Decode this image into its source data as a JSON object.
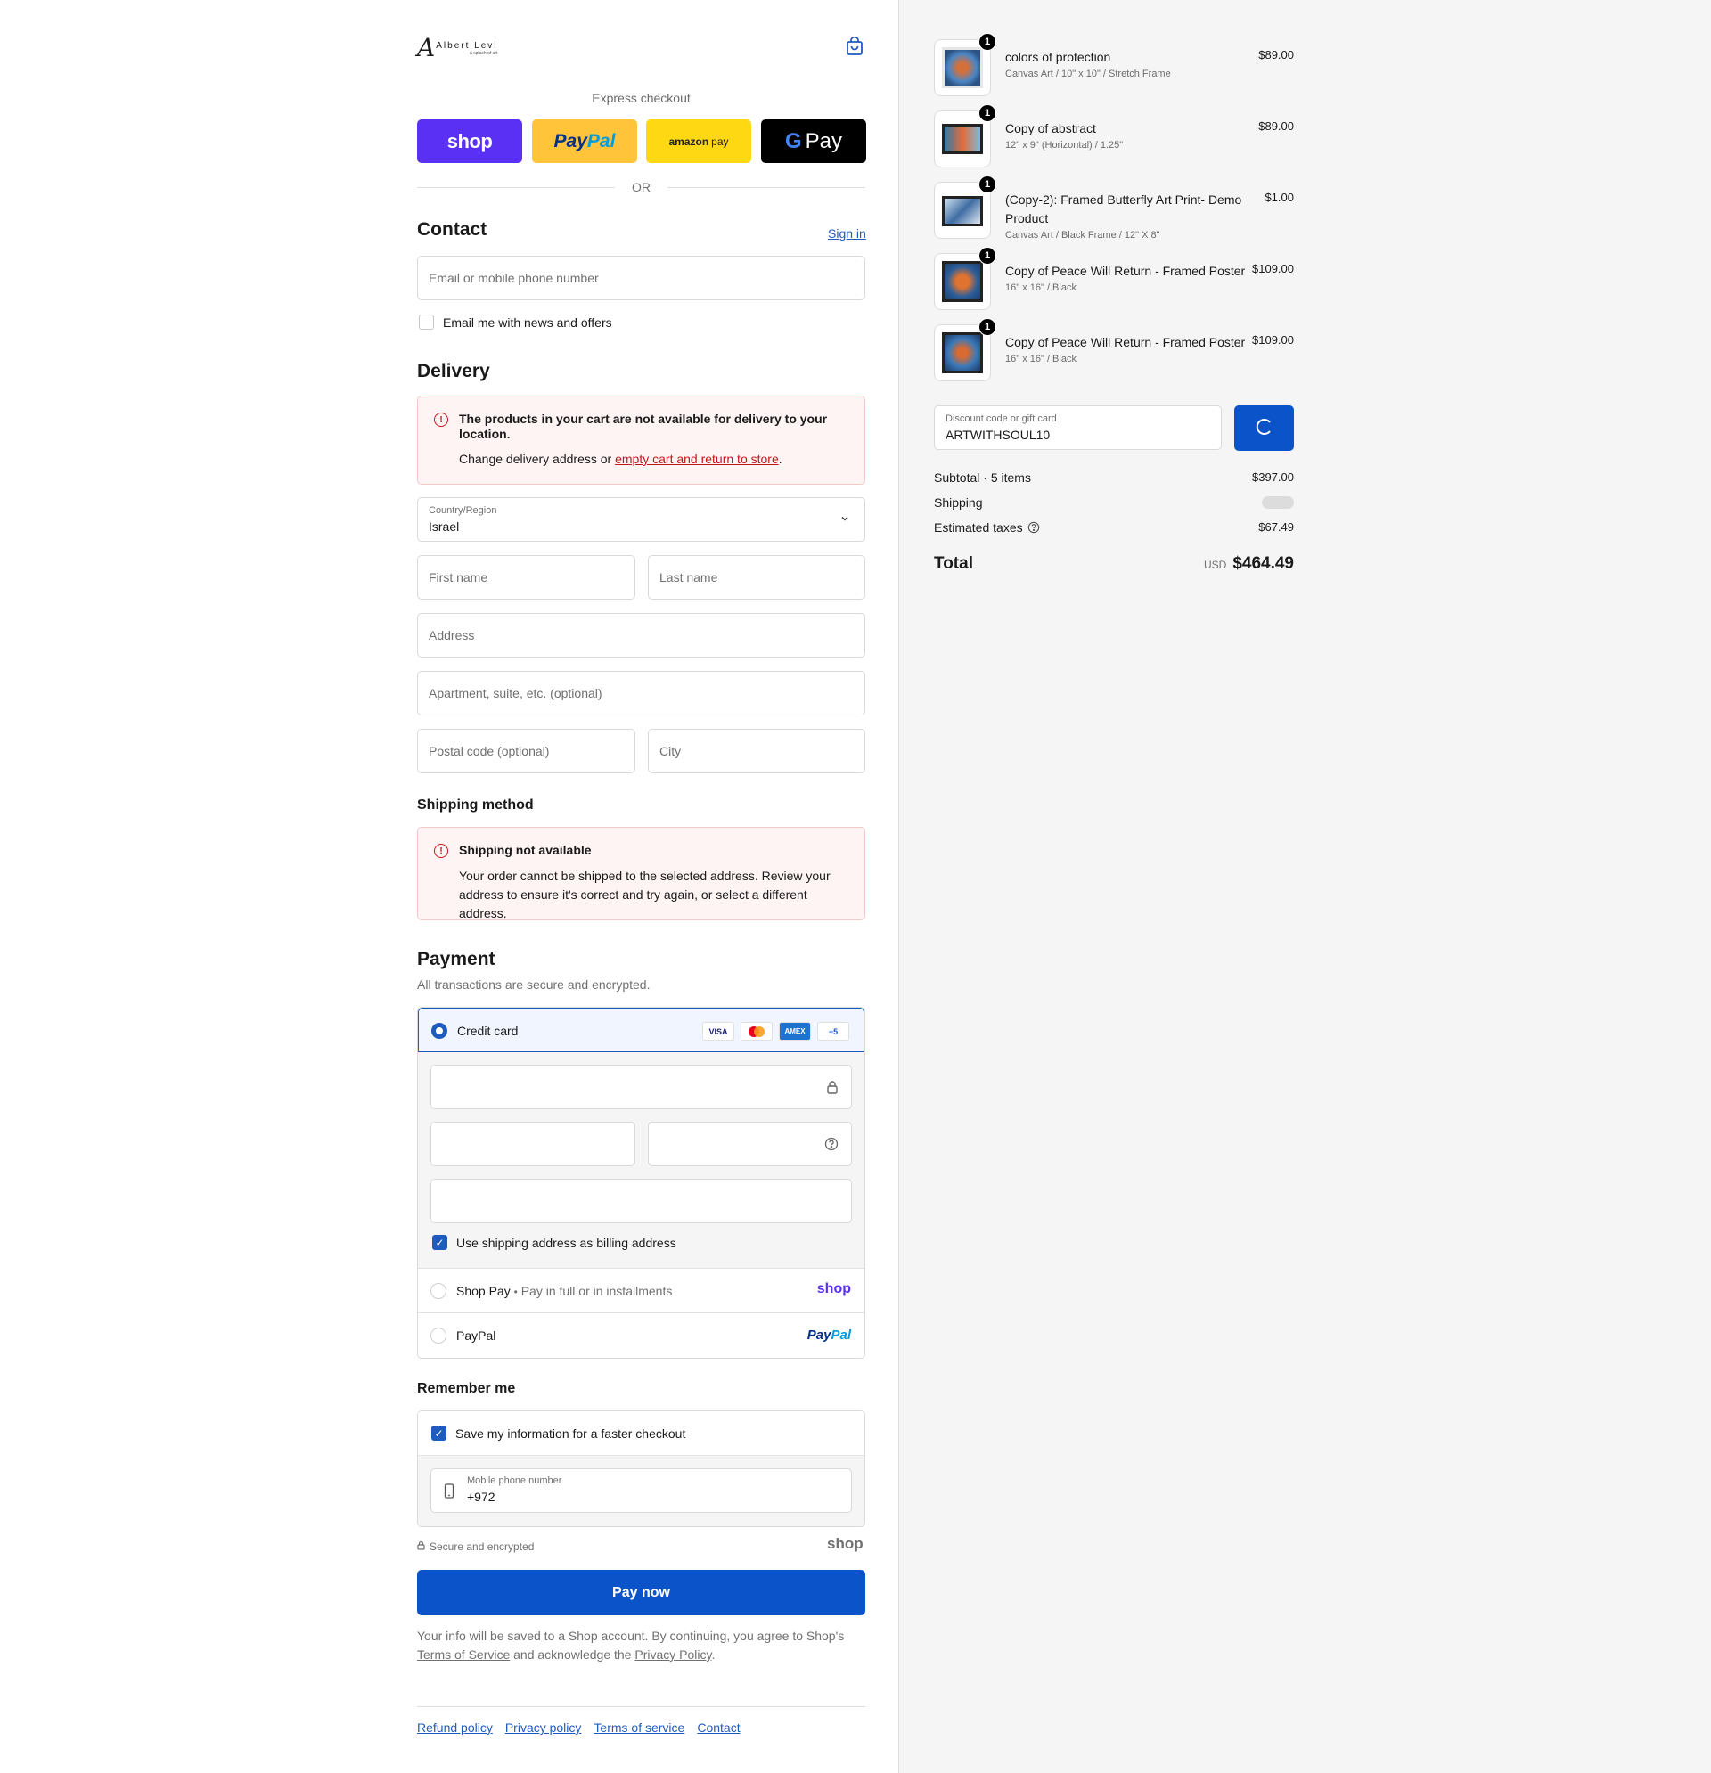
{
  "store": {
    "logo_script": "A",
    "logo_name": "Albert Levi",
    "logo_tagline": "A splash of art"
  },
  "express": {
    "title": "Express checkout",
    "shop_label": "shop",
    "paypal_pay": "Pay",
    "paypal_pal": "Pal",
    "amazon_label": "amazon",
    "amazon_pay": "pay",
    "gpay_g": "G",
    "gpay_label": "Pay",
    "or_label": "OR"
  },
  "contact": {
    "heading": "Contact",
    "sign_in": "Sign in",
    "email_placeholder": "Email or mobile phone number",
    "newsletter_label": "Email me with news and offers",
    "newsletter_checked": false
  },
  "delivery": {
    "heading": "Delivery",
    "alert_title": "The products in your cart are not available for delivery to your location.",
    "alert_body_prefix": "Change delivery address or ",
    "alert_link": "empty cart and return to store",
    "alert_body_suffix": ".",
    "country_label": "Country/Region",
    "country_value": "Israel",
    "first_name": "First name",
    "last_name": "Last name",
    "address": "Address",
    "apartment": "Apartment, suite, etc. (optional)",
    "postal": "Postal code (optional)",
    "city": "City"
  },
  "shipping": {
    "heading": "Shipping method",
    "alert_title": "Shipping not available",
    "alert_body": "Your order cannot be shipped to the selected address. Review your address to ensure it's correct and try again, or select a different address."
  },
  "payment": {
    "heading": "Payment",
    "subtitle": "All transactions are secure and encrypted.",
    "credit_card": "Credit card",
    "cards": [
      "VISA",
      "",
      "AMEX",
      "+5"
    ],
    "billing_label": "Use shipping address as billing address",
    "billing_checked": true,
    "shop_pay": "Shop Pay",
    "shop_pay_dot": "•",
    "shop_pay_sub": "Pay in full or in installments",
    "shop_pay_logo": "shop",
    "paypal": "PayPal",
    "paypal_logo_pay": "Pay",
    "paypal_logo_pal": "Pal"
  },
  "remember": {
    "heading": "Remember me",
    "save_label": "Save my information for a faster checkout",
    "save_checked": true,
    "phone_label": "Mobile phone number",
    "phone_value": "+972",
    "secure": "Secure and encrypted",
    "shop_logo": "shop"
  },
  "pay_button": "Pay now",
  "legal": {
    "prefix": "Your info will be saved to a Shop account. By continuing, you agree to Shop's ",
    "terms": "Terms of Service",
    "mid": " and acknowledge the ",
    "privacy": "Privacy Policy",
    "suffix": "."
  },
  "footer": [
    "Refund policy",
    "Privacy policy",
    "Terms of service",
    "Contact"
  ],
  "cart": {
    "items": [
      {
        "name": "colors of protection",
        "variant": "Canvas Art / 10\" x 10\" / Stretch Frame",
        "price": "$89.00",
        "qty": "1"
      },
      {
        "name": "Copy of abstract",
        "variant": "12\" x 9\" (Horizontal) / 1.25\"",
        "price": "$89.00",
        "qty": "1"
      },
      {
        "name": "(Copy-2): Framed Butterfly Art Print- Demo Product",
        "variant": "Canvas Art / Black Frame / 12\" X 8\"",
        "price": "$1.00",
        "qty": "1"
      },
      {
        "name": "Copy of Peace Will Return - Framed Poster",
        "variant": "16\" x 16\" / Black",
        "price": "$109.00",
        "qty": "1"
      },
      {
        "name": "Copy of Peace Will Return - Framed Poster",
        "variant": "16\" x 16\" / Black",
        "price": "$109.00",
        "qty": "1"
      }
    ],
    "discount_label": "Discount code or gift card",
    "discount_value": "ARTWITHSOUL10",
    "subtotal_label": "Subtotal · 5 items",
    "subtotal": "$397.00",
    "shipping_label": "Shipping",
    "taxes_label": "Estimated taxes",
    "taxes": "$67.49",
    "total_label": "Total",
    "currency": "USD",
    "total": "$464.49"
  },
  "colors": {
    "accent": "#1f5bbf",
    "shop": "#5a31f4",
    "paypal": "#ffc439",
    "amazon": "#ffd814",
    "error": "#c4161c"
  }
}
